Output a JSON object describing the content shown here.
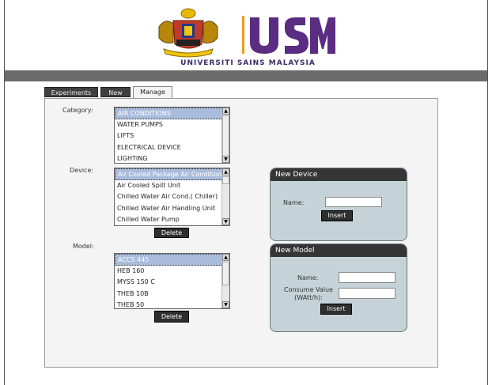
{
  "header": {
    "brand_name": "UNIVERSITI SAINS MALAYSIA",
    "logo_letters": "USM",
    "colors": {
      "band": "#6b6b6b",
      "usm_purple": "#5a2d82",
      "usm_orange": "#f39a1e",
      "tab_dark": "#3f3f3f"
    }
  },
  "tabs": [
    {
      "label": "Experiments",
      "active": false
    },
    {
      "label": "New",
      "active": false
    },
    {
      "label": "Manage",
      "active": true
    }
  ],
  "category": {
    "label": "Category:",
    "items": [
      "AIR CONDITIONS",
      "WATER PUMPS",
      "LIFTS",
      "ELECTRICAL DEVICE",
      "LIGHTING"
    ],
    "selected_index": 0
  },
  "device": {
    "label": "Device:",
    "items": [
      "Air Cooled Package Air Condition",
      "Air Cooled Spilt Unit",
      "Chilled Water Air Cond.( Chiller)",
      "Chilled Water Air Handling Unit",
      "Chilled Water Pump"
    ],
    "selected_index": 0,
    "delete_label": "Delete"
  },
  "model": {
    "label": "Model:",
    "items": [
      "ACCS 445",
      "HEB 160",
      "MYSS 150 C",
      "THEB 10B",
      "THEB 50"
    ],
    "selected_index": 0,
    "delete_label": "Delete"
  },
  "new_device": {
    "title": "New Device",
    "name_label": "Name:",
    "name_value": "",
    "insert_label": "Insert"
  },
  "new_model": {
    "title": "New Model",
    "name_label": "Name:",
    "name_value": "",
    "consume_label_line1": "Consume Value",
    "consume_label_line2": "(WAtt/h):",
    "consume_value": "",
    "insert_label": "Insert"
  }
}
